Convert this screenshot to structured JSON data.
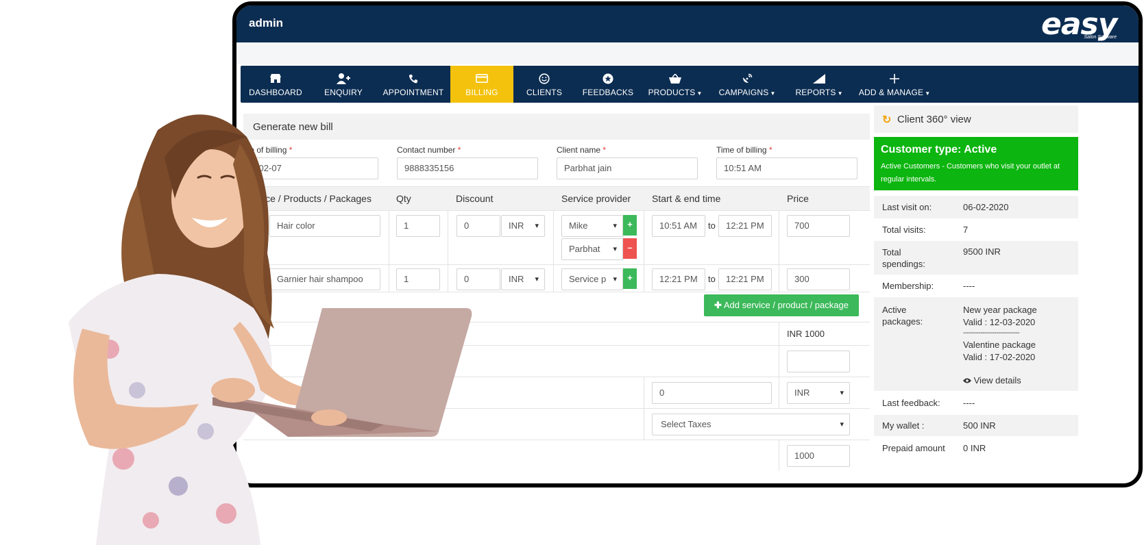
{
  "topbar": {
    "user": "admin",
    "logo_word": "easy",
    "logo_sub": "Salon Software"
  },
  "nav": [
    {
      "label": "DASHBOARD",
      "icon": "store-icon",
      "caret": false,
      "active": false
    },
    {
      "label": "ENQUIRY",
      "icon": "add-user-icon",
      "caret": false,
      "active": false
    },
    {
      "label": "APPOINTMENT",
      "icon": "phone-icon",
      "caret": false,
      "active": false
    },
    {
      "label": "BILLING",
      "icon": "card-icon",
      "caret": false,
      "active": true
    },
    {
      "label": "CLIENTS",
      "icon": "smiley-icon",
      "caret": false,
      "active": false
    },
    {
      "label": "FEEDBACKS",
      "icon": "star-icon",
      "caret": false,
      "active": false
    },
    {
      "label": "PRODUCTS",
      "icon": "basket-icon",
      "caret": true,
      "active": false
    },
    {
      "label": "CAMPAIGNS",
      "icon": "satellite-icon",
      "caret": true,
      "active": false
    },
    {
      "label": "REPORTS",
      "icon": "bar-chart-icon",
      "caret": true,
      "active": false
    },
    {
      "label": "ADD & MANAGE",
      "icon": "plus-icon",
      "caret": true,
      "active": false
    }
  ],
  "bill": {
    "title": "Generate new bill",
    "date_label": "te of billing",
    "date_value": "0-02-07",
    "contact_label": "Contact number",
    "contact_value": "9888335156",
    "client_label": "Client name",
    "client_value": "Parbhat jain",
    "time_label": "Time of billing",
    "time_value": "10:51 AM",
    "req": "*",
    "columns": {
      "service": "vice / Products / Packages",
      "qty": "Qty",
      "discount": "Discount",
      "provider": "Service provider",
      "time": "Start & end time",
      "price": "Price"
    },
    "rows": [
      {
        "service": "Hair color",
        "qty": "1",
        "discount": "0",
        "currency": "INR",
        "providers": [
          "Mike",
          "Parbhat"
        ],
        "start": "10:51 AM",
        "end": "12:21 PM",
        "price": "700"
      },
      {
        "service": "Garnier hair shampoo",
        "qty": "1",
        "discount": "0",
        "currency": "INR",
        "providers": [
          "Service p"
        ],
        "start": "12:21 PM",
        "end": "12:21 PM",
        "price": "300"
      }
    ],
    "to": "to",
    "plus": "+",
    "minus": "–",
    "add_button": "Add service / product / package",
    "subtotal": "INR 1000",
    "extra_discount": "0",
    "extra_currency": "INR",
    "taxes_placeholder": "Select Taxes",
    "grand_total": "1000"
  },
  "client360": {
    "title": "Client 360° view",
    "type_heading": "Customer type: Active",
    "type_desc": "Active Customers - Customers who visit your outlet at regular intervals.",
    "rows": [
      {
        "k": "Last visit on:",
        "v": "06-02-2020"
      },
      {
        "k": "Total visits:",
        "v": "7"
      },
      {
        "k": "Total spendings:",
        "v": "9500 INR"
      },
      {
        "k": "Membership:",
        "v": "----"
      },
      {
        "k": "Active packages:",
        "v": ""
      },
      {
        "k": "Last feedback:",
        "v": "----"
      },
      {
        "k": "My wallet :",
        "v": "500 INR"
      },
      {
        "k": "Prepaid amount",
        "v": "0 INR"
      }
    ],
    "packages": [
      {
        "name": "New year package",
        "valid": "Valid : 12-03-2020"
      },
      {
        "name": "Valentine package",
        "valid": "Valid : 17-02-2020"
      }
    ],
    "pkg_separator": "-----------------------------",
    "view_details": "View details"
  },
  "colors": {
    "navy": "#0c2d52",
    "active_tab": "#f4c20d",
    "green": "#0cb50f",
    "button_green": "#3cb95a",
    "danger": "#ef5350"
  }
}
